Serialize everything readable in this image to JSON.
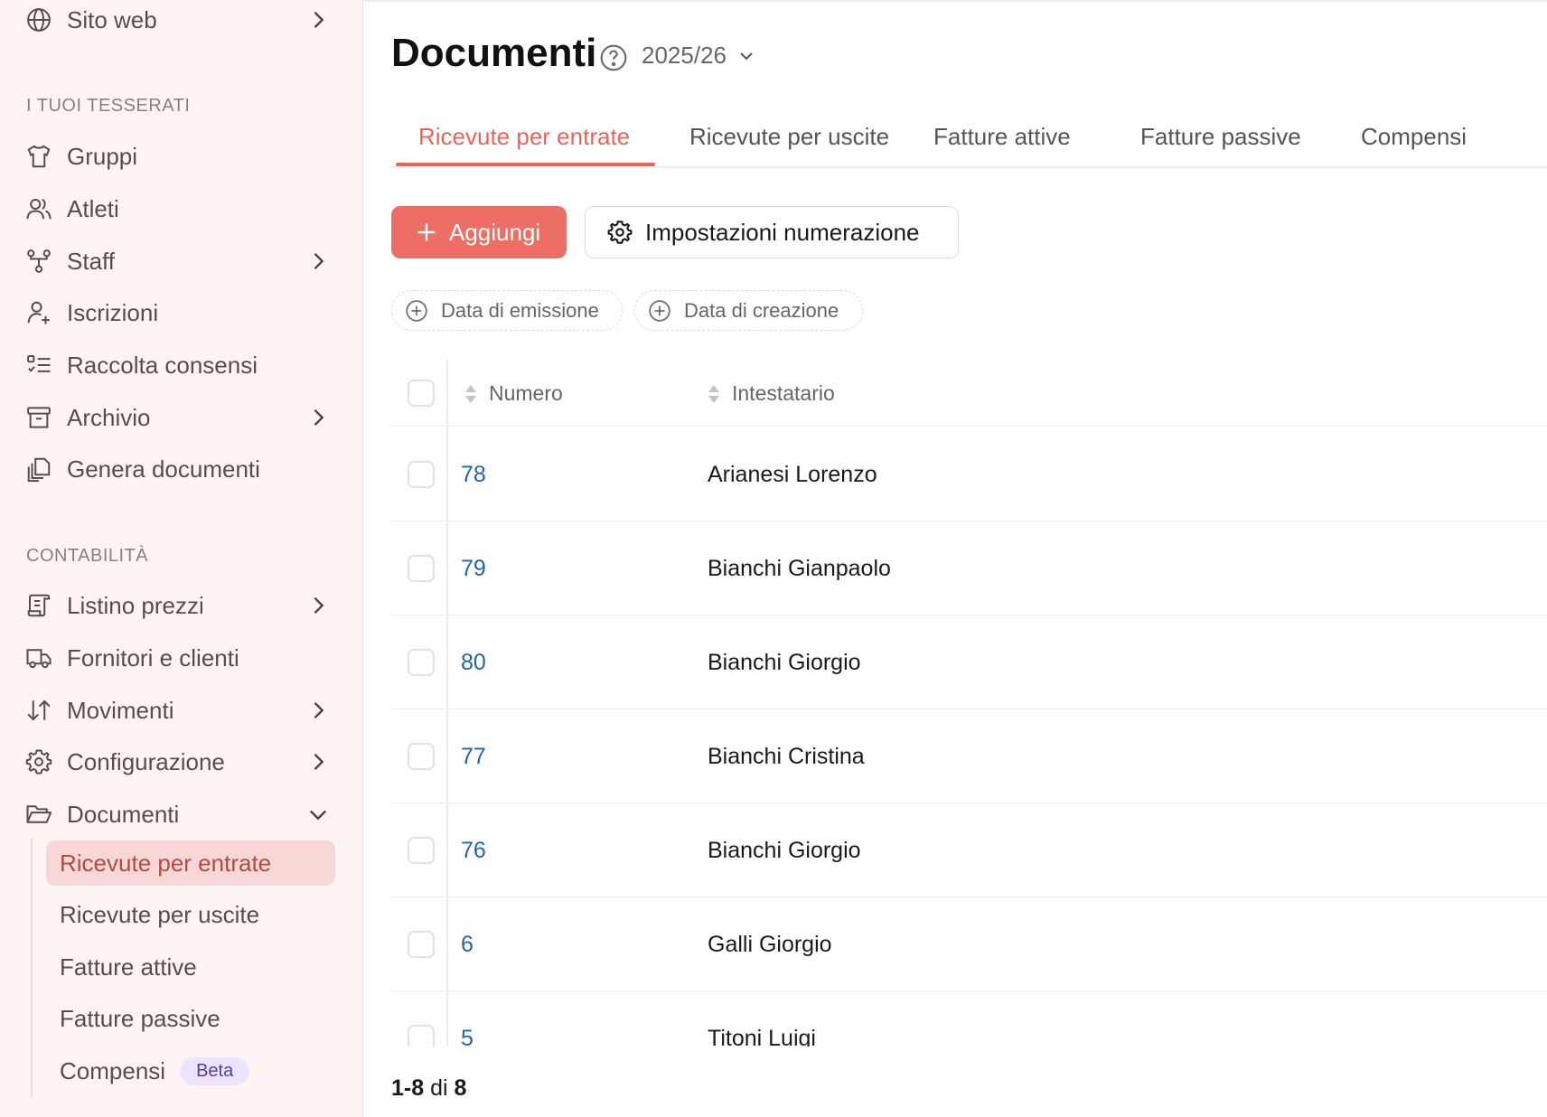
{
  "sidebar": {
    "top_item": {
      "label": "Sito web",
      "icon": "globe-icon"
    },
    "sections": [
      {
        "title": "I TUOI TESSERATI",
        "items": [
          {
            "label": "Gruppi",
            "icon": "shirt-icon",
            "has_chevron": false
          },
          {
            "label": "Atleti",
            "icon": "users-icon",
            "has_chevron": false
          },
          {
            "label": "Staff",
            "icon": "network-icon",
            "has_chevron": true
          },
          {
            "label": "Iscrizioni",
            "icon": "user-plus-icon",
            "has_chevron": false
          },
          {
            "label": "Raccolta consensi",
            "icon": "list-check-icon",
            "has_chevron": false
          },
          {
            "label": "Archivio",
            "icon": "archive-icon",
            "has_chevron": true
          },
          {
            "label": "Genera documenti",
            "icon": "documents-icon",
            "has_chevron": false
          }
        ]
      },
      {
        "title": "CONTABILITÀ",
        "items": [
          {
            "label": "Listino prezzi",
            "icon": "scroll-icon",
            "has_chevron": true
          },
          {
            "label": "Fornitori e clienti",
            "icon": "truck-icon",
            "has_chevron": false
          },
          {
            "label": "Movimenti",
            "icon": "arrows-updown-icon",
            "has_chevron": true
          },
          {
            "label": "Configurazione",
            "icon": "gear-icon",
            "has_chevron": true
          },
          {
            "label": "Documenti",
            "icon": "folder-open-icon",
            "has_chevron": true,
            "expanded": true
          }
        ]
      }
    ],
    "documenti_subitems": [
      {
        "label": "Ricevute per entrate",
        "active": true
      },
      {
        "label": "Ricevute per uscite",
        "active": false
      },
      {
        "label": "Fatture attive",
        "active": false
      },
      {
        "label": "Fatture passive",
        "active": false
      },
      {
        "label": "Compensi",
        "active": false,
        "badge": "Beta"
      }
    ]
  },
  "header": {
    "title": "Documenti",
    "season": "2025/26"
  },
  "tabs": [
    {
      "label": "Ricevute per entrate",
      "active": true
    },
    {
      "label": "Ricevute per uscite",
      "active": false
    },
    {
      "label": "Fatture attive",
      "active": false
    },
    {
      "label": "Fatture passive",
      "active": false
    },
    {
      "label": "Compensi",
      "active": false
    }
  ],
  "toolbar": {
    "add_label": "Aggiungi",
    "numbering_label": "Impostazioni numerazione"
  },
  "filters": [
    {
      "label": "Data di emissione"
    },
    {
      "label": "Data di creazione"
    }
  ],
  "table": {
    "columns": [
      "Numero",
      "Intestatario"
    ],
    "rows": [
      {
        "numero": "78",
        "intestatario": "Arianesi Lorenzo"
      },
      {
        "numero": "79",
        "intestatario": "Bianchi Gianpaolo"
      },
      {
        "numero": "80",
        "intestatario": "Bianchi Giorgio"
      },
      {
        "numero": "77",
        "intestatario": "Bianchi Cristina"
      },
      {
        "numero": "76",
        "intestatario": "Bianchi Giorgio"
      },
      {
        "numero": "6",
        "intestatario": "Galli Giorgio"
      },
      {
        "numero": "5",
        "intestatario": "Titoni Luigi"
      }
    ]
  },
  "pagination": {
    "range": "1-8",
    "separator": "di",
    "total": "8"
  },
  "colors": {
    "accent": "#e8655b",
    "sidebar_bg": "#fdf5f4",
    "active_subitem_bg": "#f8d8d6",
    "link": "#2563a8",
    "beta_bg": "#ede5ff"
  }
}
